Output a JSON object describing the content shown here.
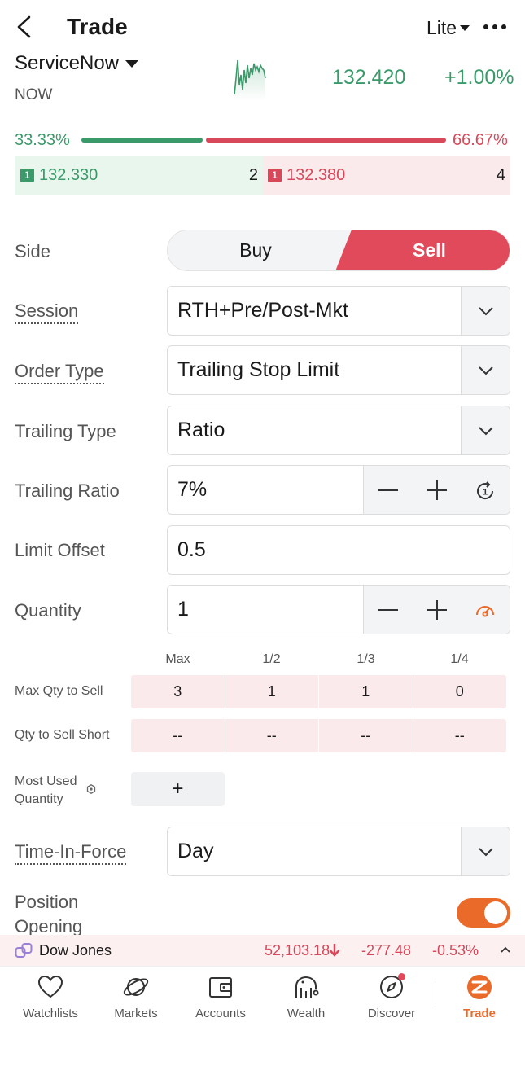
{
  "header": {
    "title": "Trade",
    "mode_label": "Lite"
  },
  "stock": {
    "name": "ServiceNow",
    "ticker": "NOW",
    "price": "132.420",
    "change_pct": "+1.00%",
    "up_color": "#3a9a6a",
    "down_color": "#d9485a"
  },
  "order_book": {
    "bid_pct": "33.33%",
    "ask_pct": "66.67%",
    "bid_ratio": 0.3333,
    "bid_level": "1",
    "bid_price": "132.330",
    "bid_size": "2",
    "ask_level": "1",
    "ask_price": "132.380",
    "ask_size": "4"
  },
  "form": {
    "side": {
      "label": "Side",
      "buy": "Buy",
      "sell": "Sell",
      "selected": "Sell"
    },
    "session": {
      "label": "Session",
      "value": "RTH+Pre/Post-Mkt"
    },
    "order_type": {
      "label": "Order Type",
      "value": "Trailing Stop Limit"
    },
    "trailing_type": {
      "label": "Trailing Type",
      "value": "Ratio"
    },
    "trailing_ratio": {
      "label": "Trailing Ratio",
      "value": "7%"
    },
    "limit_offset": {
      "label": "Limit Offset",
      "value": "0.5"
    },
    "quantity": {
      "label": "Quantity",
      "value": "1"
    }
  },
  "qty_table": {
    "columns": [
      "Max",
      "1/2",
      "1/3",
      "1/4"
    ],
    "rows": [
      {
        "label": "Max Qty to Sell",
        "values": [
          "3",
          "1",
          "1",
          "0"
        ]
      },
      {
        "label": "Qty to Sell Short",
        "values": [
          "--",
          "--",
          "--",
          "--"
        ]
      }
    ]
  },
  "most_used": {
    "label_line1": "Most Used",
    "label_line2": "Quantity",
    "add": "+"
  },
  "time_in_force": {
    "label": "Time-In-Force",
    "value": "Day"
  },
  "position_opening": {
    "label_line1": "Position",
    "label_line2": "Opening",
    "enabled": true,
    "accent": "#ea6a2a"
  },
  "index_ticker": {
    "name": "Dow Jones",
    "price": "52,103.18",
    "change": "-277.48",
    "change_pct": "-0.53%"
  },
  "bottom_nav": {
    "items": [
      {
        "label": "Watchlists",
        "icon": "heart-icon"
      },
      {
        "label": "Markets",
        "icon": "planet-icon"
      },
      {
        "label": "Accounts",
        "icon": "wallet-icon"
      },
      {
        "label": "Wealth",
        "icon": "wealth-icon"
      },
      {
        "label": "Discover",
        "icon": "compass-icon"
      },
      {
        "label": "Trade",
        "icon": "trade-logo-icon"
      }
    ],
    "active": "Trade"
  }
}
